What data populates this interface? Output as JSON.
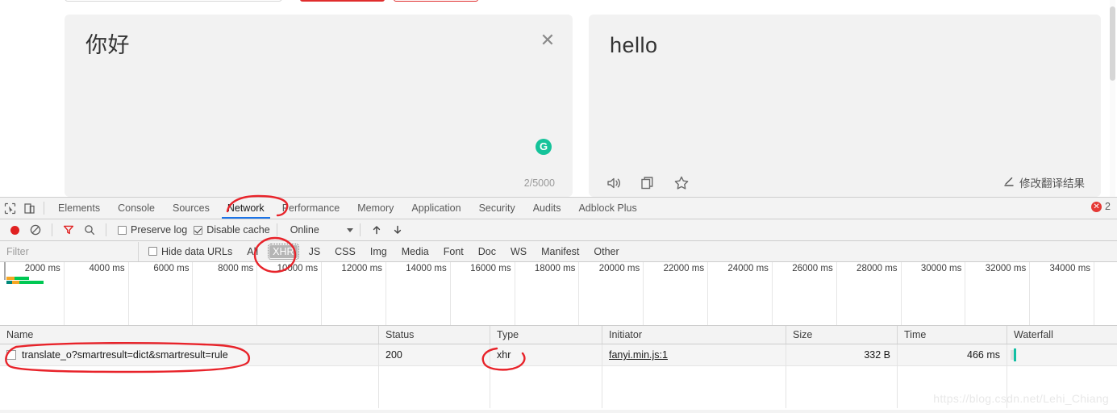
{
  "translate_page": {
    "source_panel": {
      "text": "你好",
      "close_icon": "close-icon",
      "grammarly_icon": "grammarly-icon",
      "grammarly_glyph": "G",
      "counter": "2/5000"
    },
    "target_panel": {
      "text": "hello",
      "icons": [
        "speaker-icon",
        "copy-icon",
        "star-icon"
      ],
      "edit_link": "修改翻译结果",
      "edit_icon": "pencil-icon"
    }
  },
  "devtools": {
    "tabbar": {
      "inspect_icon": "inspect-element-icon",
      "device_icon": "device-toolbar-icon",
      "tabs": [
        {
          "label": "Elements",
          "active": false
        },
        {
          "label": "Console",
          "active": false
        },
        {
          "label": "Sources",
          "active": false
        },
        {
          "label": "Network",
          "active": true
        },
        {
          "label": "Performance",
          "active": false
        },
        {
          "label": "Memory",
          "active": false
        },
        {
          "label": "Application",
          "active": false
        },
        {
          "label": "Security",
          "active": false
        },
        {
          "label": "Audits",
          "active": false
        },
        {
          "label": "Adblock Plus",
          "active": false
        }
      ],
      "error_count": "2"
    },
    "toolbar": {
      "record_icon": "record-icon",
      "clear_icon": "clear-icon",
      "filter_icon": "filter-icon",
      "search_icon": "search-icon",
      "preserve_log_label": "Preserve log",
      "preserve_log_checked": false,
      "disable_cache_label": "Disable cache",
      "disable_cache_checked": true,
      "throttle_value": "Online",
      "import_icon": "import-har-icon",
      "export_icon": "export-har-icon"
    },
    "filterbar": {
      "filter_placeholder": "Filter",
      "filter_value": "",
      "hide_data_urls_label": "Hide data URLs",
      "hide_data_urls_checked": false,
      "types": [
        "All",
        "XHR",
        "JS",
        "CSS",
        "Img",
        "Media",
        "Font",
        "Doc",
        "WS",
        "Manifest",
        "Other"
      ],
      "selected_type": "XHR"
    },
    "overview": {
      "ticks": [
        "2000 ms",
        "4000 ms",
        "6000 ms",
        "8000 ms",
        "10000 ms",
        "12000 ms",
        "14000 ms",
        "16000 ms",
        "18000 ms",
        "20000 ms",
        "22000 ms",
        "24000 ms",
        "26000 ms",
        "28000 ms",
        "30000 ms",
        "32000 ms",
        "34000 ms"
      ],
      "bars": [
        {
          "segments": [
            {
              "color": "#f5a623",
              "width": 10
            },
            {
              "color": "#00c853",
              "width": 18
            }
          ]
        },
        {
          "segments": [
            {
              "color": "#00897b",
              "width": 7
            },
            {
              "color": "#f5a623",
              "width": 9
            },
            {
              "color": "#00c853",
              "width": 30
            }
          ]
        }
      ]
    },
    "table": {
      "columns": [
        "Name",
        "Status",
        "Type",
        "Initiator",
        "Size",
        "Time",
        "Waterfall"
      ],
      "rows": [
        {
          "name": "translate_o?smartresult=dict&smartresult=rule",
          "status": "200",
          "type": "xhr",
          "initiator": "fanyi.min.js:1",
          "size": "332 B",
          "time": "466 ms"
        }
      ]
    }
  },
  "watermark": "https://blog.csdn.net/Lehi_Chiang",
  "colors": {
    "accent_red": "#e8232a",
    "tab_underline": "#1a73e8",
    "waterfall": "#12bfa3",
    "grammarly": "#15c39a"
  }
}
